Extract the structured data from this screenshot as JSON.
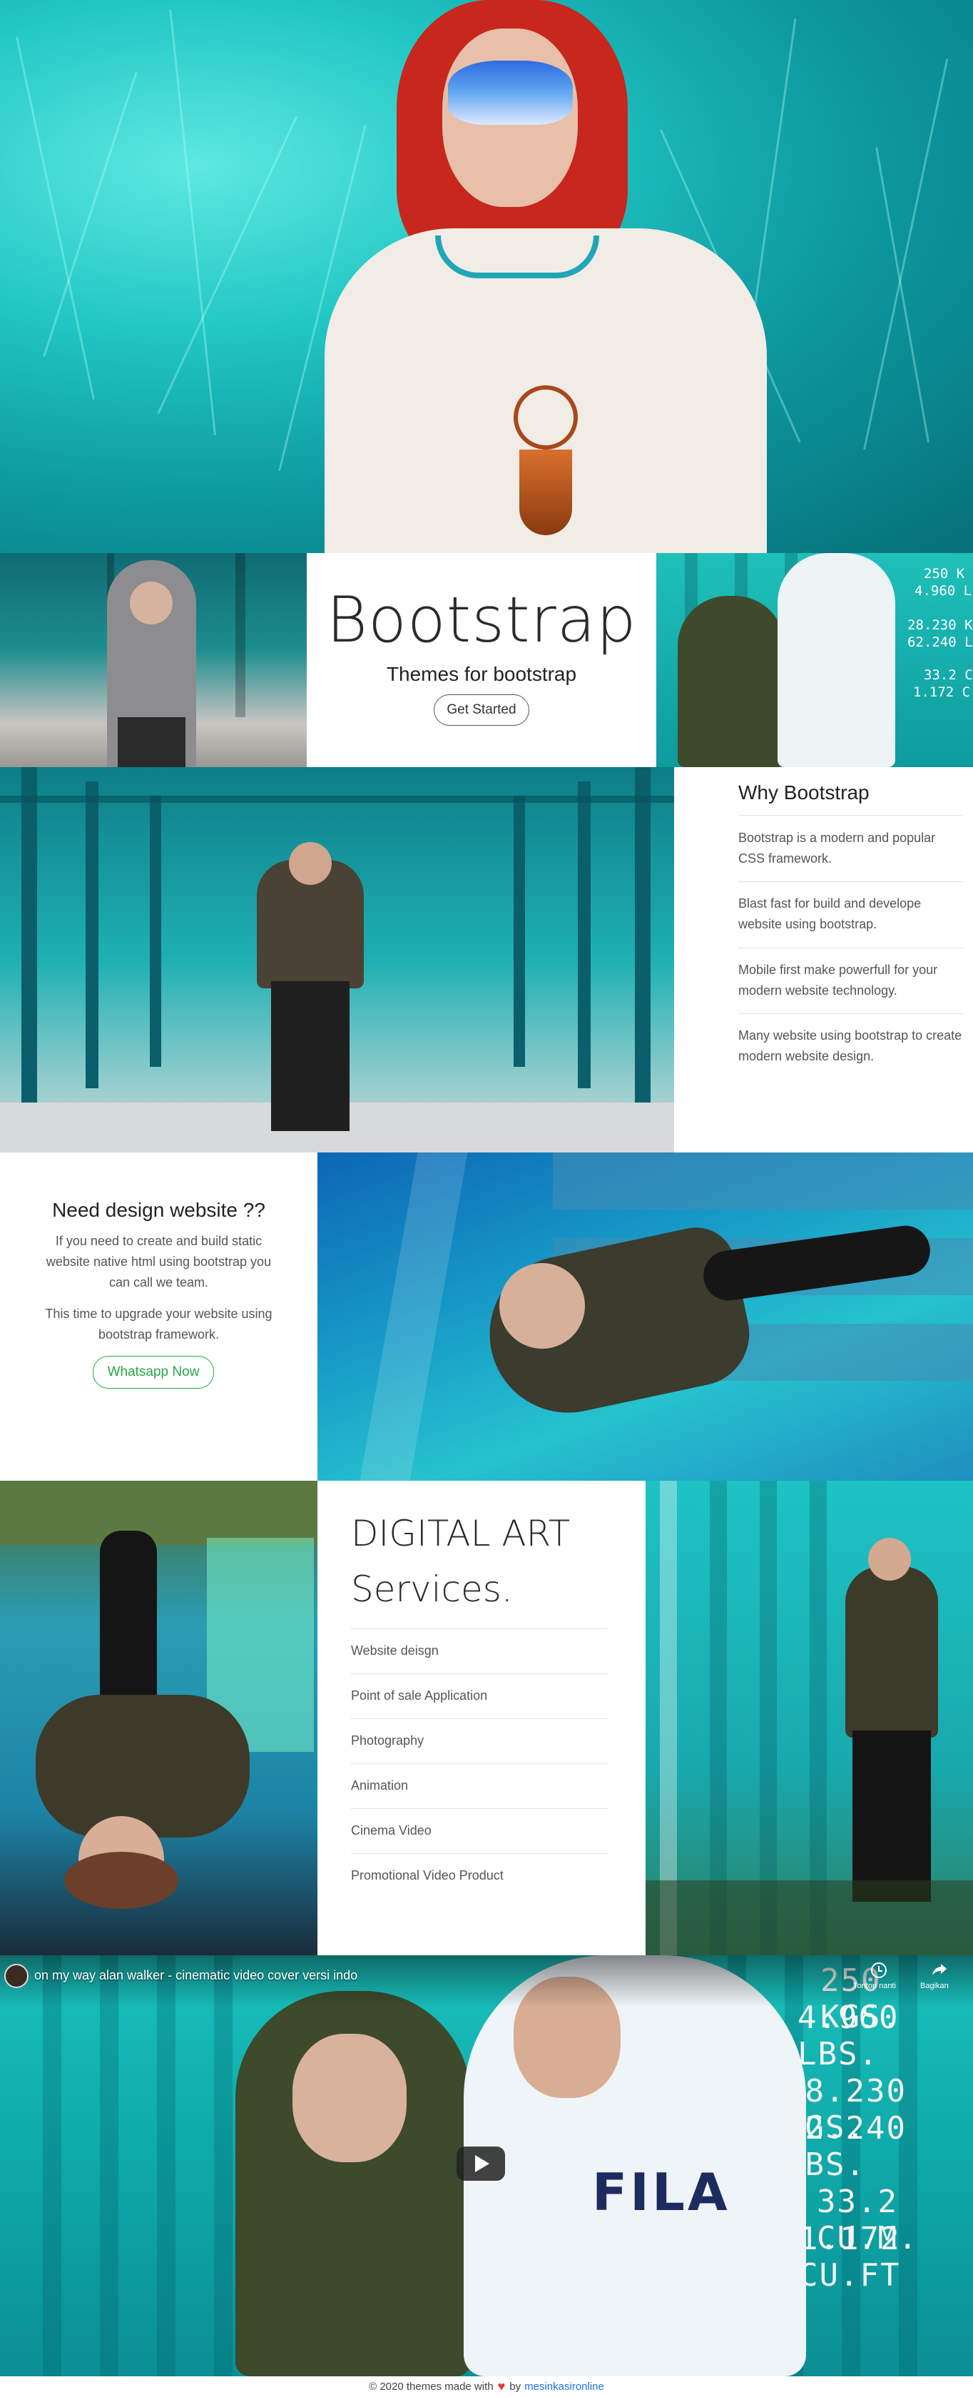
{
  "hero": {
    "image_alt": "woman with red hair and face paint in teal grass"
  },
  "bootstrap_banner": {
    "title": "Bootstrap",
    "subtitle": "Themes for bootstrap",
    "button_label": "Get Started"
  },
  "container_tags": {
    "line1": "250 K",
    "line2": "4.960 L",
    "line3": "28.230 K",
    "line4": "62.240 L",
    "line5": "33.2 C",
    "line6": "1.172 C"
  },
  "why": {
    "heading": "Why Bootstrap",
    "items": [
      "Bootstrap is a modern and popular CSS framework.",
      "Blast fast for build and develope website using bootstrap.",
      "Mobile first make powerfull for your modern website technology.",
      "Many website using bootstrap to create modern website design."
    ]
  },
  "need": {
    "heading": "Need design website ??",
    "paragraph1": "If you need to create and build static website native html using bootstrap you can call we team.",
    "paragraph2": "This time to upgrade your website using bootstrap framework.",
    "button_label": "Whatsapp Now"
  },
  "services": {
    "title_line1": "DIGITAL ART",
    "title_line2": "Services.",
    "items": [
      "Website deisgn",
      "Point of sale Application",
      "Photography",
      "Animation",
      "Cinema Video",
      "Promotional Video Product"
    ]
  },
  "video": {
    "title": "on my way alan walker - cinematic video cover versi indo",
    "watch_later_label": "Tonton nanti",
    "share_label": "Bagikan",
    "cargo": {
      "l1": "250 KGS.",
      "l2": "4.960 LBS.",
      "l3": "28.230 KGS.",
      "l4": "62.240 LBS.",
      "l5": "33.2 CU.M.",
      "l6": "1.172 CU.FT"
    },
    "hoodie_brand": "FILA"
  },
  "footer": {
    "text_before": "© 2020 themes made with",
    "heart": "♥",
    "text_by": "by",
    "link": "mesinkasironline"
  },
  "colors": {
    "teal_light": "#22c7c4",
    "teal_dark": "#066f78",
    "button_green": "#28a745",
    "link_blue": "#1a73e8",
    "heart_red": "#e53935"
  }
}
